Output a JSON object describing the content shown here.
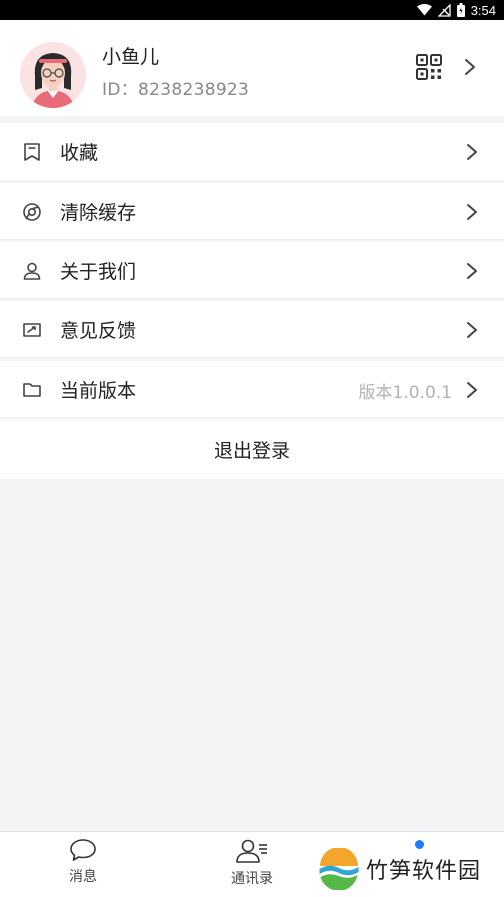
{
  "status_bar": {
    "time": "3:54"
  },
  "profile": {
    "name": "小鱼儿",
    "id_line": "ID：8238238923"
  },
  "menu": {
    "favorites": "收藏",
    "clear_cache": "清除缓存",
    "about_us": "关于我们",
    "feedback": "意见反馈",
    "current_version": "当前版本",
    "version_value": "版本1.0.0.1"
  },
  "logout_label": "退出登录",
  "tabs": {
    "messages": "消息",
    "contacts": "通讯录"
  },
  "watermark": "竹笋软件园",
  "colors": {
    "accent": "#1e7bff",
    "background": "#f3f4f6",
    "muted_text": "#888888"
  }
}
